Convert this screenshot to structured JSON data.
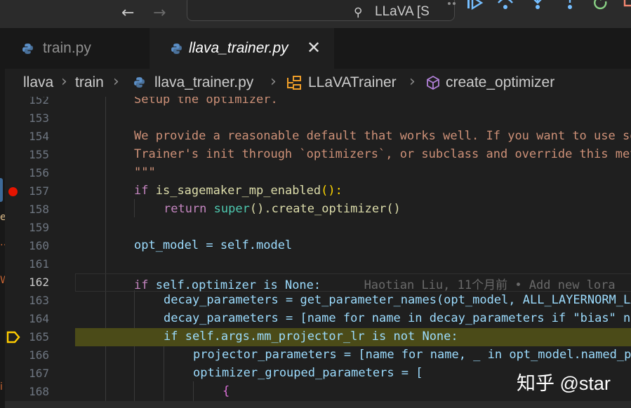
{
  "titlebar": {
    "back_arrow": "←",
    "forward_arrow": "→",
    "search_text": "LLaVA [S"
  },
  "tabs": [
    {
      "label": "train.py",
      "active": false
    },
    {
      "label": "llava_trainer.py",
      "active": true,
      "close": "✕"
    }
  ],
  "breadcrumb": {
    "items": [
      "llava",
      "train",
      "llava_trainer.py",
      "LLaVATrainer",
      "create_optimizer"
    ],
    "separator": "›"
  },
  "editor": {
    "lines": [
      {
        "num": "152",
        "text": "Setup the optimizer."
      },
      {
        "num": "153",
        "text": ""
      },
      {
        "num": "154",
        "text": "We provide a reasonable default that works well. If you want to use something else, you can pass a tuple in the"
      },
      {
        "num": "155",
        "text": "Trainer's init through `optimizers`, or subclass and override this method in a subclass."
      },
      {
        "num": "156",
        "text": "\"\"\""
      },
      {
        "num": "157",
        "kw": "if",
        "fn": "is_sagemaker_mp_enabled",
        "rest": "():"
      },
      {
        "num": "158",
        "kw": "return",
        "fn": "super",
        "rest": "().create_optimizer()"
      },
      {
        "num": "159",
        "text": ""
      },
      {
        "num": "160",
        "text": "opt_model = self.model"
      },
      {
        "num": "161",
        "text": ""
      },
      {
        "num": "162",
        "kw": "if",
        "cond": "self.optimizer is None:",
        "blame": "Haotian Liu, 11个月前 • Add new lora"
      },
      {
        "num": "163",
        "text": "decay_parameters = get_parameter_names(opt_model, ALL_LAYERNORM_LAYERS)"
      },
      {
        "num": "164",
        "text": "decay_parameters = [name for name in decay_parameters if \"bias\" not in name]"
      },
      {
        "num": "165",
        "text": "if self.args.mm_projector_lr is not None:"
      },
      {
        "num": "166",
        "text": "projector_parameters = [name for name, _ in opt_model.named_parameters() if \"mm_projector\" in name]"
      },
      {
        "num": "167",
        "text": "optimizer_grouped_parameters = ["
      },
      {
        "num": "168",
        "text": "{"
      }
    ],
    "active_line": "162",
    "breakpoint_line": "157",
    "execution_line": "165"
  },
  "colors": {
    "breakpoint": "#e51400",
    "execution_highlight": "#4b4b18",
    "execution_arrow": "#ffcc00"
  },
  "watermark": "知乎 @star",
  "activity_glyphs": [
    "e",
    "…",
    "W",
    "i"
  ]
}
